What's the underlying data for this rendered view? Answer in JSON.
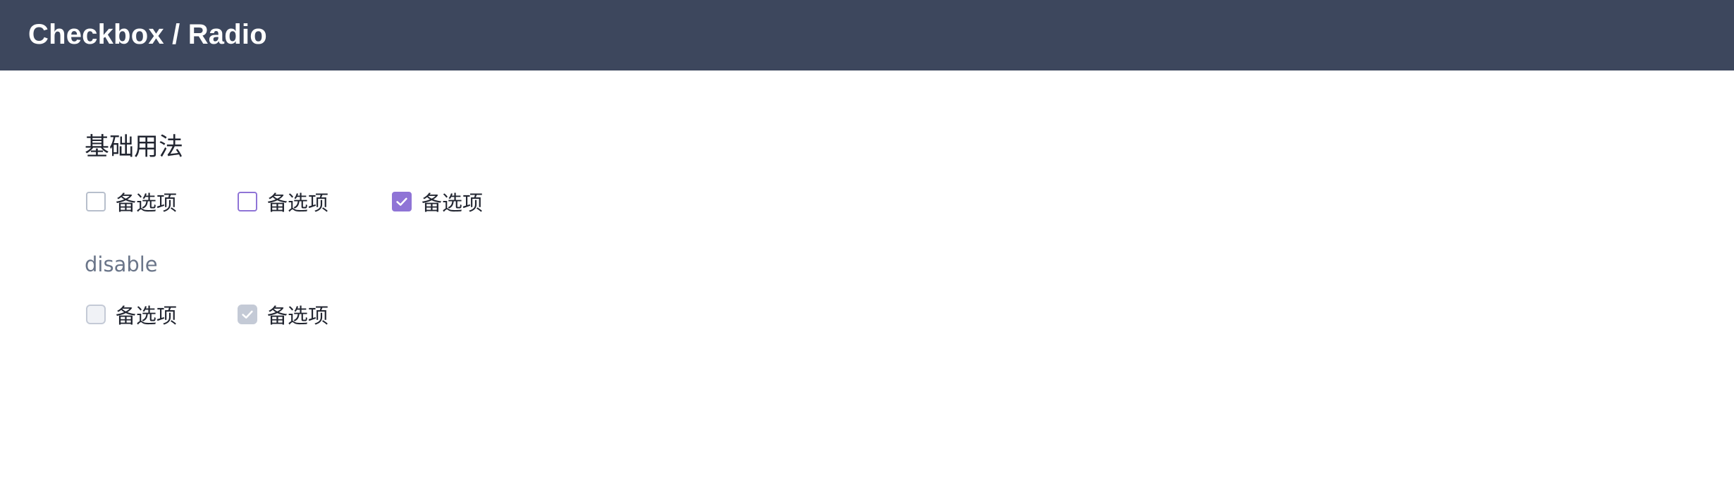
{
  "header": {
    "title": "Checkbox / Radio"
  },
  "sections": {
    "basic_title": "基础用法",
    "disabled_title": "disable"
  },
  "basic_options": [
    {
      "label": "备选项",
      "state": "unchecked"
    },
    {
      "label": "备选项",
      "state": "hover"
    },
    {
      "label": "备选项",
      "state": "checked"
    }
  ],
  "disabled_options": [
    {
      "label": "备选项",
      "state": "disabled-unchecked"
    },
    {
      "label": "备选项",
      "state": "disabled-checked"
    }
  ],
  "colors": {
    "header_bg": "#3d475d",
    "accent": "#8f74d6",
    "border": "#b7bfcc",
    "disabled": "#c4cad6"
  },
  "icons": {
    "check": "checkmark-icon"
  }
}
